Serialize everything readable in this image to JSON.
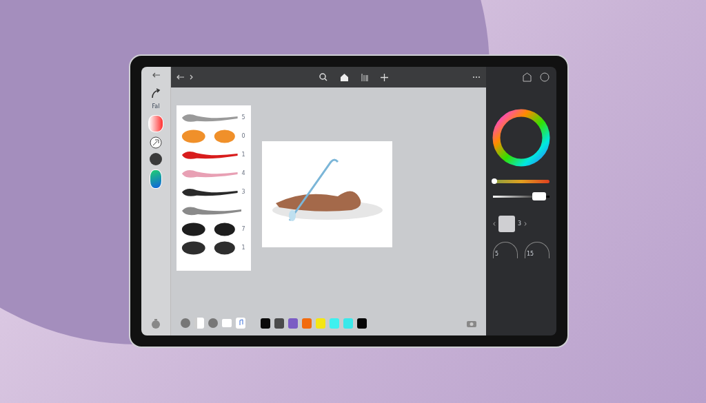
{
  "left_rail": {
    "label": "Fal"
  },
  "brushes": [
    {
      "number": "5",
      "color": "#9a9a9a",
      "kind": "stroke"
    },
    {
      "number": "0",
      "color": "#f0902a",
      "kind": "blobs"
    },
    {
      "number": "1",
      "color": "#d81c1c",
      "kind": "stroke"
    },
    {
      "number": "4",
      "color": "#e8a0b4",
      "kind": "stroke"
    },
    {
      "number": "3",
      "color": "#2a2a2a",
      "kind": "stroke"
    },
    {
      "color": "#8a8a8a",
      "kind": "stroke"
    },
    {
      "number": "7",
      "color": "#1e1e1e",
      "kind": "blobs"
    },
    {
      "number": "1",
      "color": "#2e2e2e",
      "kind": "blobs"
    }
  ],
  "color_panel": {
    "hue_slider": {
      "level": 0.02
    },
    "opacity_slider": {
      "level": 0.92
    },
    "dials": [
      {
        "label": "5"
      },
      {
        "label": "15"
      }
    ],
    "size_reading": "3"
  },
  "swatches": [
    {
      "color": "#0a0a0a"
    },
    {
      "color": "#4a4a4a"
    },
    {
      "color": "#7b5cc4"
    },
    {
      "color": "#f26b0f"
    },
    {
      "color": "#f5e614"
    },
    {
      "color": "#3ef0ef"
    },
    {
      "color": "#3be8ea"
    },
    {
      "color": "#050505"
    }
  ]
}
